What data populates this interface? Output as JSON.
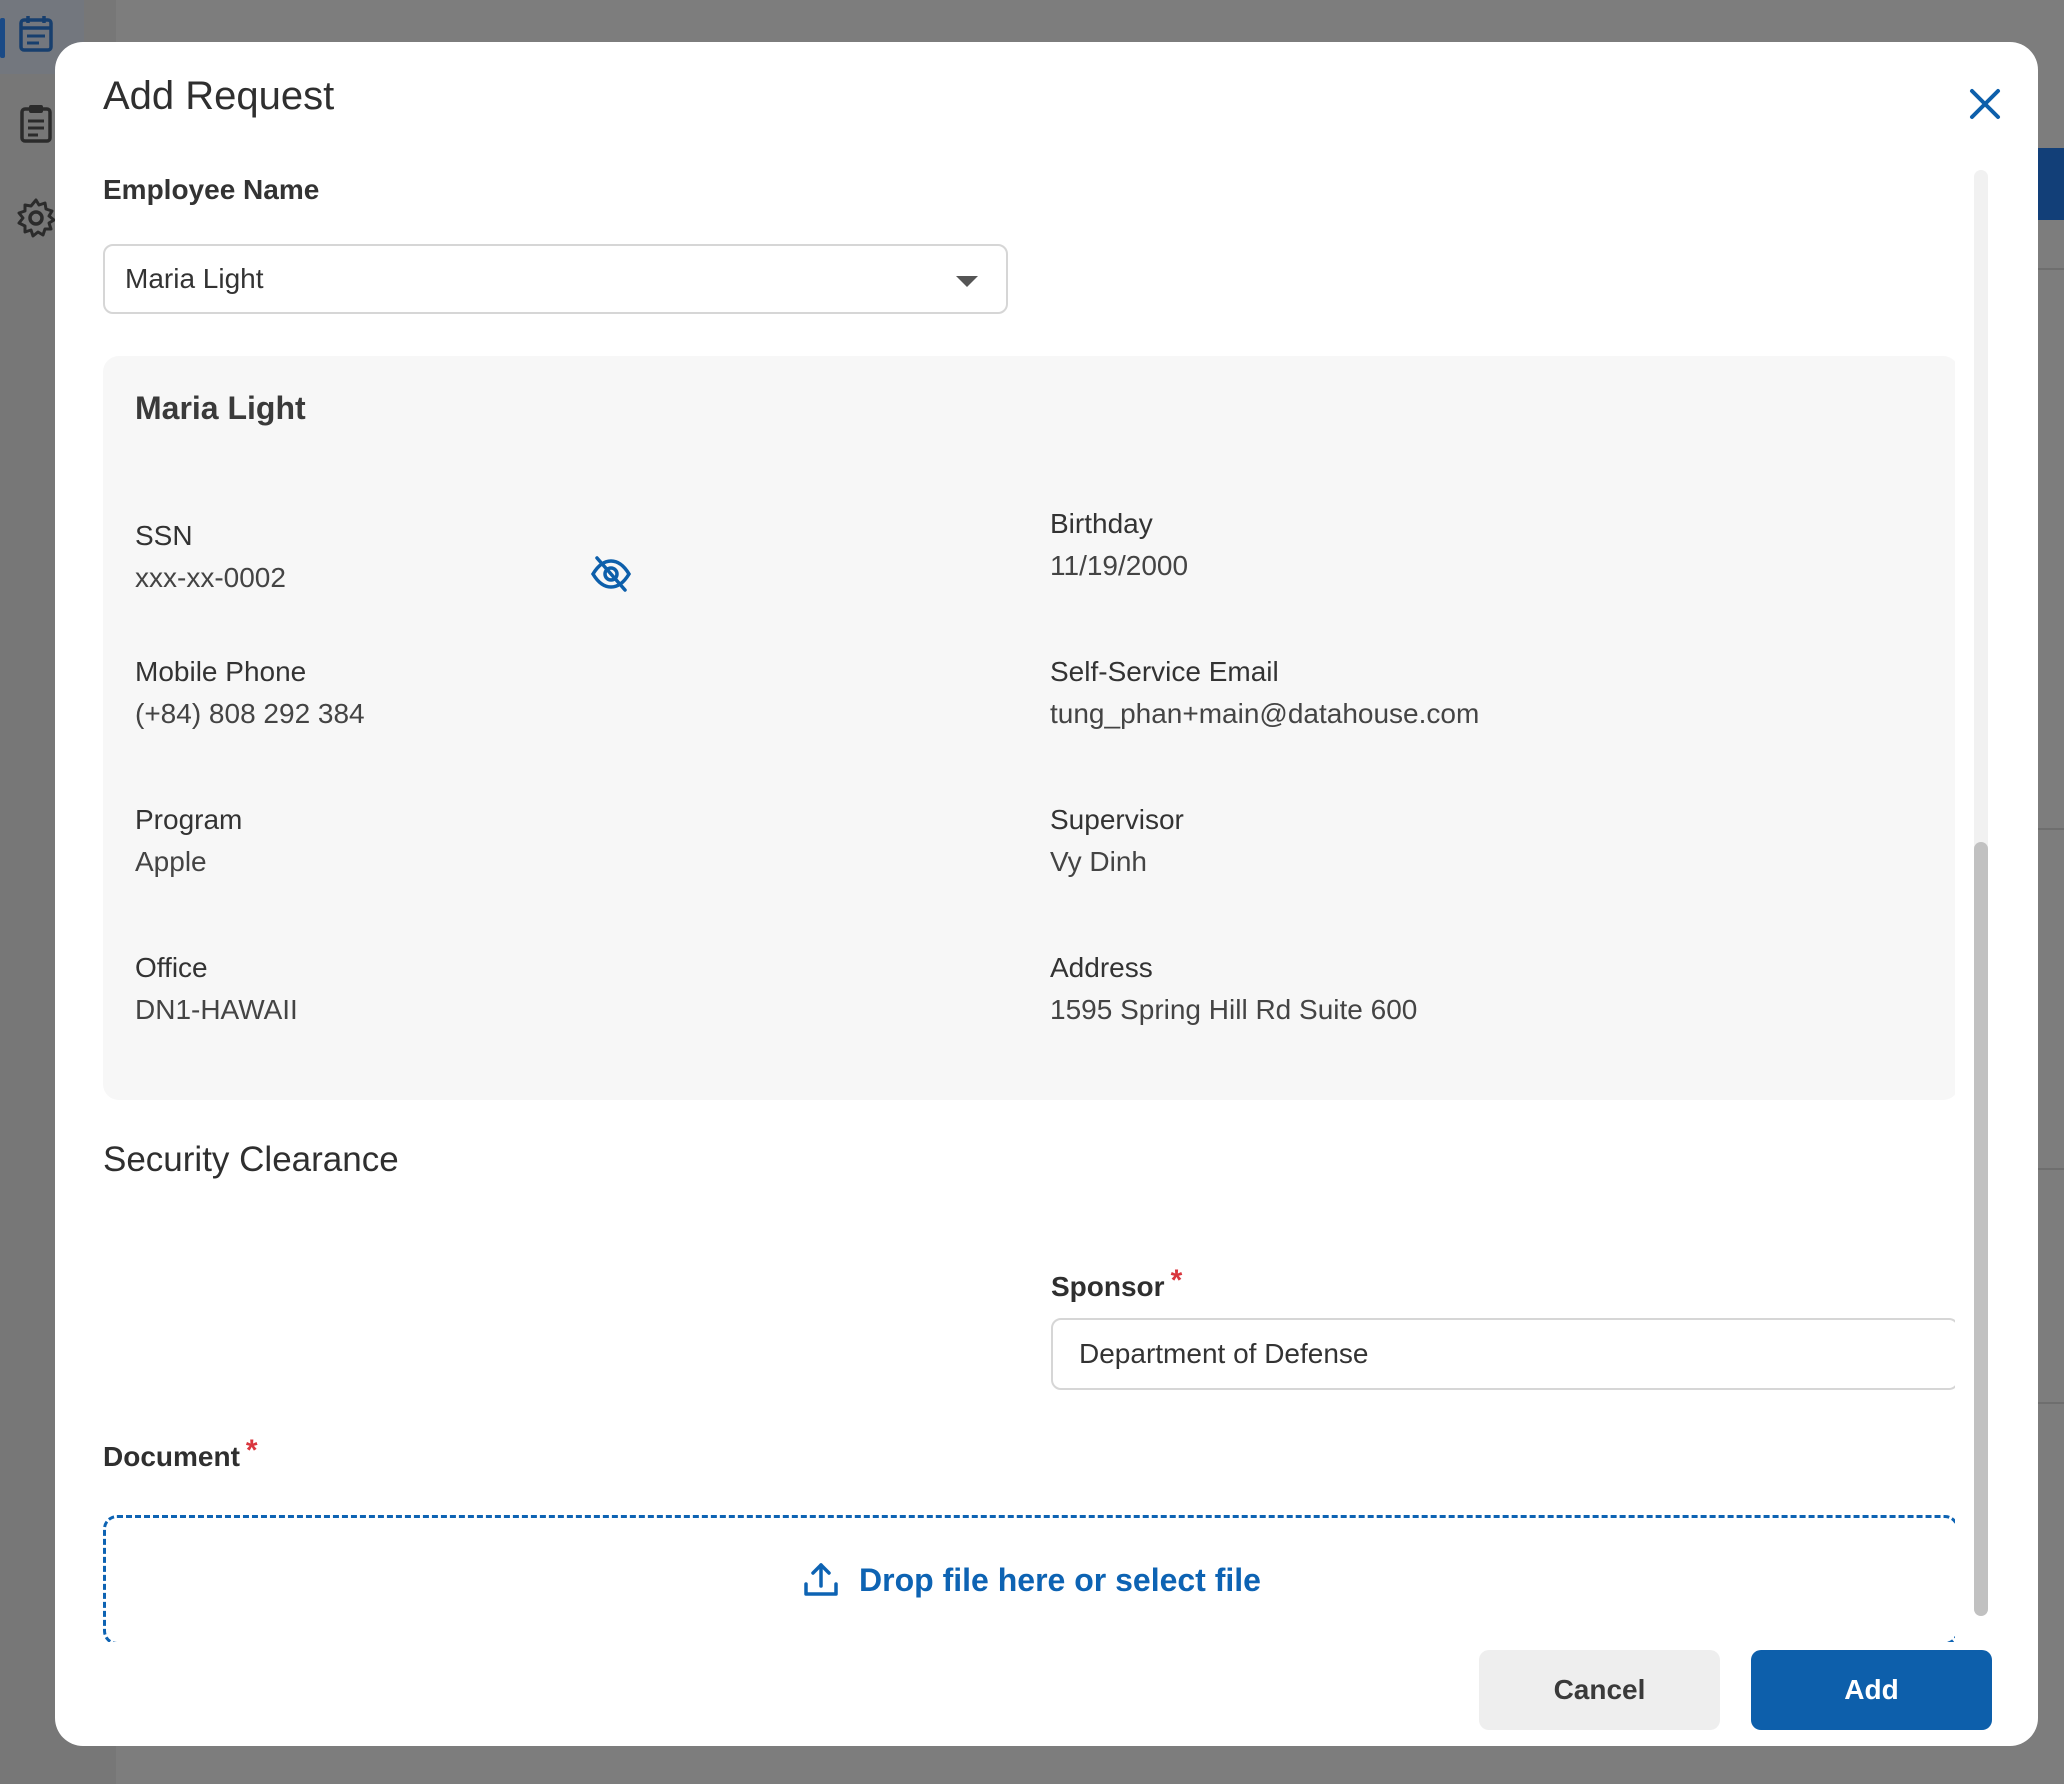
{
  "modal": {
    "title": "Add Request"
  },
  "employee_field": {
    "label": "Employee Name",
    "selected_value": "Maria Light"
  },
  "employee_card": {
    "name": "Maria Light",
    "ssn_label": "SSN",
    "ssn_value": "xxx-xx-0002",
    "birthday_label": "Birthday",
    "birthday_value": "11/19/2000",
    "mobile_label": "Mobile Phone",
    "mobile_value": "(+84) 808 292 384",
    "email_label": "Self-Service Email",
    "email_value": "tung_phan+main@datahouse.com",
    "program_label": "Program",
    "program_value": "Apple",
    "supervisor_label": "Supervisor",
    "supervisor_value": "Vy Dinh",
    "office_label": "Office",
    "office_value": "DN1-HAWAII",
    "address_label": "Address",
    "address_value": "1595 Spring Hill Rd Suite 600"
  },
  "security_section": {
    "title": "Security Clearance",
    "sponsor_label": "Sponsor",
    "sponsor_value": "Department of Defense",
    "document_label": "Document",
    "dropzone_text": "Drop file here or select file",
    "required_mark": "*"
  },
  "footer": {
    "cancel_label": "Cancel",
    "add_label": "Add"
  },
  "colors": {
    "primary": "#0d5fab",
    "required": "#d9363e",
    "card_bg": "#f7f7f7"
  },
  "icons": {
    "close": "close-icon",
    "eye": "eye-off-icon",
    "upload": "upload-icon",
    "dropdown": "chevron-down-icon"
  }
}
